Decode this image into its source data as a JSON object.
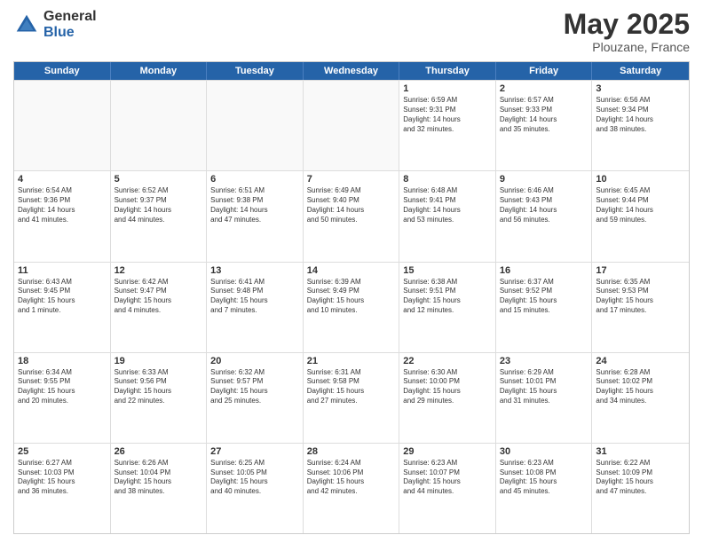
{
  "logo": {
    "general": "General",
    "blue": "Blue"
  },
  "title": {
    "month": "May 2025",
    "location": "Plouzane, France"
  },
  "header_days": [
    "Sunday",
    "Monday",
    "Tuesday",
    "Wednesday",
    "Thursday",
    "Friday",
    "Saturday"
  ],
  "rows": [
    [
      {
        "day": "",
        "text": "",
        "empty": true
      },
      {
        "day": "",
        "text": "",
        "empty": true
      },
      {
        "day": "",
        "text": "",
        "empty": true
      },
      {
        "day": "",
        "text": "",
        "empty": true
      },
      {
        "day": "1",
        "text": "Sunrise: 6:59 AM\nSunset: 9:31 PM\nDaylight: 14 hours\nand 32 minutes.",
        "empty": false
      },
      {
        "day": "2",
        "text": "Sunrise: 6:57 AM\nSunset: 9:33 PM\nDaylight: 14 hours\nand 35 minutes.",
        "empty": false
      },
      {
        "day": "3",
        "text": "Sunrise: 6:56 AM\nSunset: 9:34 PM\nDaylight: 14 hours\nand 38 minutes.",
        "empty": false
      }
    ],
    [
      {
        "day": "4",
        "text": "Sunrise: 6:54 AM\nSunset: 9:36 PM\nDaylight: 14 hours\nand 41 minutes.",
        "empty": false
      },
      {
        "day": "5",
        "text": "Sunrise: 6:52 AM\nSunset: 9:37 PM\nDaylight: 14 hours\nand 44 minutes.",
        "empty": false
      },
      {
        "day": "6",
        "text": "Sunrise: 6:51 AM\nSunset: 9:38 PM\nDaylight: 14 hours\nand 47 minutes.",
        "empty": false
      },
      {
        "day": "7",
        "text": "Sunrise: 6:49 AM\nSunset: 9:40 PM\nDaylight: 14 hours\nand 50 minutes.",
        "empty": false
      },
      {
        "day": "8",
        "text": "Sunrise: 6:48 AM\nSunset: 9:41 PM\nDaylight: 14 hours\nand 53 minutes.",
        "empty": false
      },
      {
        "day": "9",
        "text": "Sunrise: 6:46 AM\nSunset: 9:43 PM\nDaylight: 14 hours\nand 56 minutes.",
        "empty": false
      },
      {
        "day": "10",
        "text": "Sunrise: 6:45 AM\nSunset: 9:44 PM\nDaylight: 14 hours\nand 59 minutes.",
        "empty": false
      }
    ],
    [
      {
        "day": "11",
        "text": "Sunrise: 6:43 AM\nSunset: 9:45 PM\nDaylight: 15 hours\nand 1 minute.",
        "empty": false
      },
      {
        "day": "12",
        "text": "Sunrise: 6:42 AM\nSunset: 9:47 PM\nDaylight: 15 hours\nand 4 minutes.",
        "empty": false
      },
      {
        "day": "13",
        "text": "Sunrise: 6:41 AM\nSunset: 9:48 PM\nDaylight: 15 hours\nand 7 minutes.",
        "empty": false
      },
      {
        "day": "14",
        "text": "Sunrise: 6:39 AM\nSunset: 9:49 PM\nDaylight: 15 hours\nand 10 minutes.",
        "empty": false
      },
      {
        "day": "15",
        "text": "Sunrise: 6:38 AM\nSunset: 9:51 PM\nDaylight: 15 hours\nand 12 minutes.",
        "empty": false
      },
      {
        "day": "16",
        "text": "Sunrise: 6:37 AM\nSunset: 9:52 PM\nDaylight: 15 hours\nand 15 minutes.",
        "empty": false
      },
      {
        "day": "17",
        "text": "Sunrise: 6:35 AM\nSunset: 9:53 PM\nDaylight: 15 hours\nand 17 minutes.",
        "empty": false
      }
    ],
    [
      {
        "day": "18",
        "text": "Sunrise: 6:34 AM\nSunset: 9:55 PM\nDaylight: 15 hours\nand 20 minutes.",
        "empty": false
      },
      {
        "day": "19",
        "text": "Sunrise: 6:33 AM\nSunset: 9:56 PM\nDaylight: 15 hours\nand 22 minutes.",
        "empty": false
      },
      {
        "day": "20",
        "text": "Sunrise: 6:32 AM\nSunset: 9:57 PM\nDaylight: 15 hours\nand 25 minutes.",
        "empty": false
      },
      {
        "day": "21",
        "text": "Sunrise: 6:31 AM\nSunset: 9:58 PM\nDaylight: 15 hours\nand 27 minutes.",
        "empty": false
      },
      {
        "day": "22",
        "text": "Sunrise: 6:30 AM\nSunset: 10:00 PM\nDaylight: 15 hours\nand 29 minutes.",
        "empty": false
      },
      {
        "day": "23",
        "text": "Sunrise: 6:29 AM\nSunset: 10:01 PM\nDaylight: 15 hours\nand 31 minutes.",
        "empty": false
      },
      {
        "day": "24",
        "text": "Sunrise: 6:28 AM\nSunset: 10:02 PM\nDaylight: 15 hours\nand 34 minutes.",
        "empty": false
      }
    ],
    [
      {
        "day": "25",
        "text": "Sunrise: 6:27 AM\nSunset: 10:03 PM\nDaylight: 15 hours\nand 36 minutes.",
        "empty": false
      },
      {
        "day": "26",
        "text": "Sunrise: 6:26 AM\nSunset: 10:04 PM\nDaylight: 15 hours\nand 38 minutes.",
        "empty": false
      },
      {
        "day": "27",
        "text": "Sunrise: 6:25 AM\nSunset: 10:05 PM\nDaylight: 15 hours\nand 40 minutes.",
        "empty": false
      },
      {
        "day": "28",
        "text": "Sunrise: 6:24 AM\nSunset: 10:06 PM\nDaylight: 15 hours\nand 42 minutes.",
        "empty": false
      },
      {
        "day": "29",
        "text": "Sunrise: 6:23 AM\nSunset: 10:07 PM\nDaylight: 15 hours\nand 44 minutes.",
        "empty": false
      },
      {
        "day": "30",
        "text": "Sunrise: 6:23 AM\nSunset: 10:08 PM\nDaylight: 15 hours\nand 45 minutes.",
        "empty": false
      },
      {
        "day": "31",
        "text": "Sunrise: 6:22 AM\nSunset: 10:09 PM\nDaylight: 15 hours\nand 47 minutes.",
        "empty": false
      }
    ]
  ]
}
